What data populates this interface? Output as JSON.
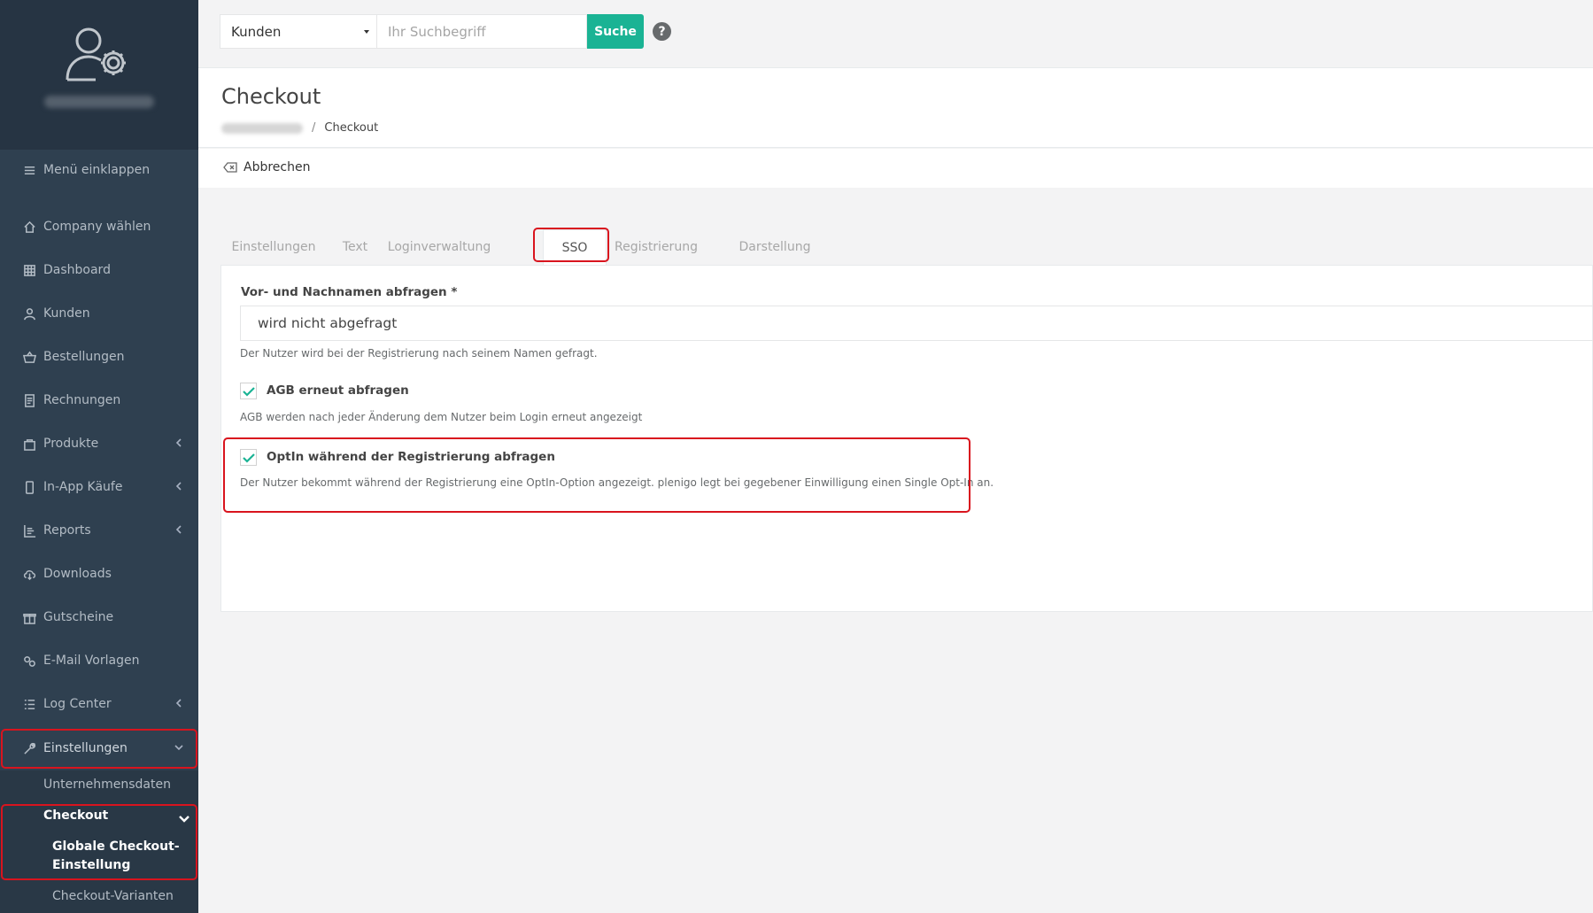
{
  "sidebar": {
    "collapse_label": "Menü einklappen",
    "items": [
      {
        "label": "Company wählen",
        "icon": "home-icon"
      },
      {
        "label": "Dashboard",
        "icon": "grid-icon"
      },
      {
        "label": "Kunden",
        "icon": "user-icon"
      },
      {
        "label": "Bestellungen",
        "icon": "basket-icon"
      },
      {
        "label": "Rechnungen",
        "icon": "invoice-icon"
      },
      {
        "label": "Produkte",
        "icon": "bag-icon"
      },
      {
        "label": "In-App Käufe",
        "icon": "phone-icon"
      },
      {
        "label": "Reports",
        "icon": "report-icon"
      },
      {
        "label": "Downloads",
        "icon": "cloud-download-icon"
      },
      {
        "label": "Gutscheine",
        "icon": "gift-icon"
      },
      {
        "label": "E-Mail Vorlagen",
        "icon": "cogs-icon"
      },
      {
        "label": "Log Center",
        "icon": "list-icon"
      },
      {
        "label": "Einstellungen",
        "icon": "wrench-icon"
      }
    ],
    "sub_items": {
      "company_data": "Unternehmensdaten",
      "checkout": "Checkout",
      "global_checkout": "Globale Checkout-",
      "global_checkout_2": "Einstellung",
      "checkout_variants": "Checkout-Varianten"
    }
  },
  "topbar": {
    "select_value": "Kunden",
    "search_placeholder": "Ihr Suchbegriff",
    "search_button": "Suche",
    "help_symbol": "?"
  },
  "page": {
    "title": "Checkout",
    "breadcrumb_current": "Checkout",
    "breadcrumb_separator": "/",
    "cancel_label": "Abbrechen"
  },
  "tabs": [
    "Einstellungen",
    "Text",
    "Loginverwaltung",
    "SSO",
    "Registrierung",
    "Darstellung"
  ],
  "active_tab": "SSO",
  "form": {
    "name_label": "Vor- und Nachnamen abfragen *",
    "name_value": "wird nicht abgefragt",
    "name_help": "Der Nutzer wird bei der Registrierung nach seinem Namen gefragt.",
    "agb_label": "AGB erneut abfragen",
    "agb_checked": true,
    "agb_help": "AGB werden nach jeder Änderung dem Nutzer beim Login erneut angezeigt",
    "optin_label": "OptIn während der Registrierung abfragen",
    "optin_checked": true,
    "optin_help": "Der Nutzer bekommt während der Registrierung eine OptIn-Option angezeigt. plenigo legt bei gegebener Einwilligung einen Single Opt-In an."
  },
  "colors": {
    "sidebar": "#2f4050",
    "accent": "#1ab394",
    "highlight": "#d9141e"
  }
}
